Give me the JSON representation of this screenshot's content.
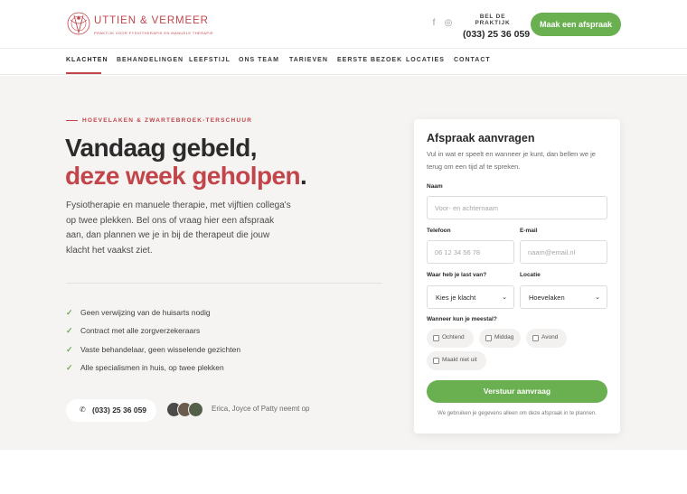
{
  "brand": {
    "name": "UTTIEN & VERMEER",
    "tagline": "PRAKTIJK VOOR FYSIOTHERAPIE EN MANUELE THERAPIE",
    "accent_color": "#c1454b",
    "cta_color": "#6aaf50"
  },
  "header": {
    "social": [
      {
        "icon": "facebook-icon",
        "glyph": "f"
      },
      {
        "icon": "instagram-icon",
        "glyph": "◎"
      }
    ],
    "call_label": "BEL DE PRAKTIJK",
    "call_number": "(033) 25 36 059",
    "cta_label": "Maak een afspraak"
  },
  "nav": {
    "items": [
      {
        "label": "KLACHTEN",
        "active": true
      },
      {
        "label": "BEHANDELINGEN",
        "active": false
      },
      {
        "label": "LEEFSTIJL",
        "active": false
      },
      {
        "label": "ONS TEAM",
        "active": false
      },
      {
        "label": "TARIEVEN",
        "active": false
      },
      {
        "label": "EERSTE BEZOEK",
        "active": false
      },
      {
        "label": "LOCATIES",
        "active": false
      },
      {
        "label": "CONTACT",
        "active": false
      }
    ]
  },
  "hero": {
    "eyebrow": "HOEVELAKEN & ZWARTEBROEK-TERSCHUUR",
    "headline_line1": "Vandaag gebeld,",
    "headline_line2": "deze week geholpen",
    "headline_period": ".",
    "intro": "Fysiotherapie en manuele therapie, met vijftien collega's op twee plekken. Bel ons of vraag hier een afspraak aan, dan plannen we je in bij de therapeut die jouw klacht het vaakst ziet.",
    "checks": [
      "Geen verwijzing van de huisarts nodig",
      "Contract met alle zorgverzekeraars",
      "Vaste behandelaar, geen wisselende gezichten",
      "Alle specialismen in huis, op twee plekken"
    ],
    "phone": "(033) 25 36 059",
    "team_text": "Erica, Joyce of Patty neemt op"
  },
  "form": {
    "title": "Afspraak aanvragen",
    "description": "Vul in wat er speelt en wanneer je kunt, dan bellen we je terug om een tijd af te spreken.",
    "name_label": "Naam",
    "name_placeholder": "Voor- en achternaam",
    "phone_label": "Telefoon",
    "phone_placeholder": "06 12 34 56 78",
    "email_label": "E-mail",
    "email_placeholder": "naam@email.nl",
    "complaint_label": "Waar heb je last van?",
    "complaint_value": "Kies je klacht",
    "location_label": "Locatie",
    "location_value": "Hoevelaken",
    "when_label": "Wanneer kun je meestal?",
    "when_options": [
      "Ochtend",
      "Middag",
      "Avond",
      "Maakt niet uit"
    ],
    "submit_label": "Verstuur aanvraag",
    "privacy": "We gebruiken je gegevens alleen om deze afspraak in te plannen."
  }
}
